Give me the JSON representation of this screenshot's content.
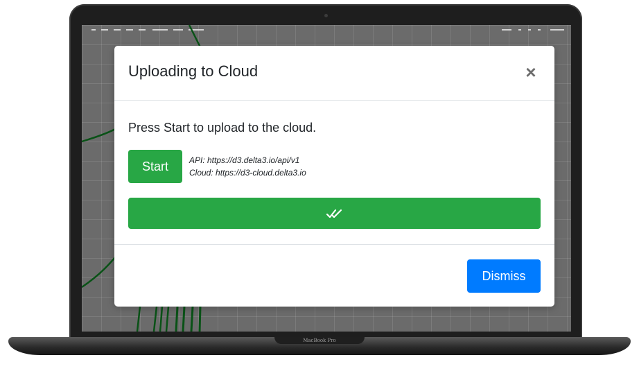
{
  "modal": {
    "title": "Uploading to Cloud",
    "close_glyph": "×",
    "body_text": "Press Start to upload to the cloud.",
    "start_label": "Start",
    "api_line": "API: https://d3.delta3.io/api/v1",
    "cloud_line": "Cloud: https://d3-cloud.delta3.io",
    "progress_percent": 100,
    "progress_icon": "double-check-icon",
    "dismiss_label": "Dismiss"
  },
  "device": {
    "brand": "MacBook Pro"
  },
  "colors": {
    "success": "#28a745",
    "primary": "#007bff",
    "text": "#212529",
    "divider": "#dee2e6"
  }
}
